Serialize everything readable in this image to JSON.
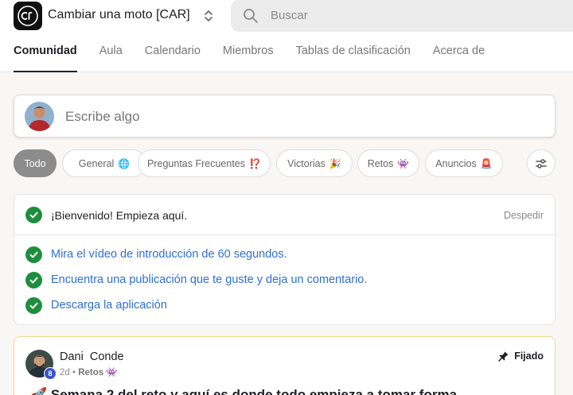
{
  "header": {
    "group_name": "Cambiar una moto [CAR]",
    "search_placeholder": "Buscar"
  },
  "tabs": [
    {
      "label": "Comunidad",
      "active": true
    },
    {
      "label": "Aula"
    },
    {
      "label": "Calendario"
    },
    {
      "label": "Miembros"
    },
    {
      "label": "Tablas de clasificación"
    },
    {
      "label": "Acerca de"
    }
  ],
  "composer": {
    "placeholder": "Escribe algo"
  },
  "filters": [
    {
      "label": "Todo",
      "active": true,
      "emoji": ""
    },
    {
      "label": "General",
      "emoji": "🌐"
    },
    {
      "label": "Preguntas Frecuentes",
      "emoji": "⁉️"
    },
    {
      "label": "Victorias",
      "emoji": "🎉"
    },
    {
      "label": "Retos",
      "emoji": "👾"
    },
    {
      "label": "Anuncios",
      "emoji": "🚨"
    }
  ],
  "welcome": {
    "title": "¡Bienvenido! Empieza aquí.",
    "dismiss": "Despedir",
    "tasks": [
      "Mira el vídeo de introducción de 60 segundos.",
      "Encuentra una publicación que te guste y deja un comentario.",
      "Descarga la aplicación"
    ]
  },
  "post": {
    "author": "Dani  Conde",
    "level": "8",
    "time": "2d",
    "separator": "•",
    "category": "Retos",
    "category_emoji": "👾",
    "pinned_label": "Fijado",
    "title": "🚀 Semana 2 del reto y aquí es donde todo empieza a tomar forma"
  },
  "colors": {
    "accent_green": "#1e8e3e",
    "link_blue": "#2f6fd6",
    "pinned_border": "#f0d78a"
  }
}
